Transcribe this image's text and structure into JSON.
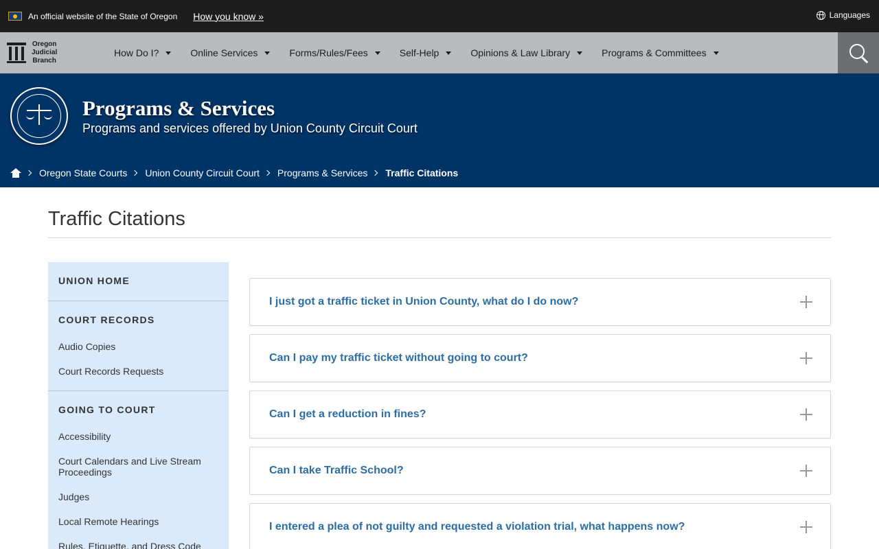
{
  "gov_banner": {
    "text": "An official website of the State of Oregon",
    "link": "How you know »",
    "languages": "Languages"
  },
  "logo": {
    "line1": "Oregon",
    "line2": "Judicial",
    "line3": "Branch"
  },
  "nav": {
    "items": [
      {
        "label": "How Do I?"
      },
      {
        "label": "Online Services"
      },
      {
        "label": "Forms/Rules/Fees"
      },
      {
        "label": "Self-Help"
      },
      {
        "label": "Opinions & Law Library"
      },
      {
        "label": "Programs & Committees"
      }
    ]
  },
  "hero": {
    "title": "Programs & Services",
    "subtitle": "Programs and services offered by Union County Circuit Court"
  },
  "breadcrumb": {
    "items": [
      {
        "label": "Oregon State Courts"
      },
      {
        "label": "Union County Circuit Court"
      },
      {
        "label": "Programs & Services"
      },
      {
        "label": "Traffic Citations"
      }
    ]
  },
  "page": {
    "title": "Traffic Citations"
  },
  "sidebar": {
    "home": "UNION HOME",
    "groups": [
      {
        "heading": "COURT RECORDS",
        "links": [
          "Audio Copies",
          "Court Records Requests"
        ]
      },
      {
        "heading": "GOING TO COURT",
        "links": [
          "Accessibility",
          "Court Calendars and Live Stream Proceedings",
          "Judges",
          "Local Remote Hearings",
          "Rules, Etiquette, and Dress Code"
        ]
      }
    ]
  },
  "faqs": [
    {
      "question": "I just got a traffic ticket in Union County, what do I do now?"
    },
    {
      "question": "Can I pay my traffic ticket without going to court?"
    },
    {
      "question": "Can I get a reduction in fines?"
    },
    {
      "question": "Can I take Traffic School?"
    },
    {
      "question": "I entered a plea of not guilty and requested a violation trial, what happens now?"
    }
  ]
}
